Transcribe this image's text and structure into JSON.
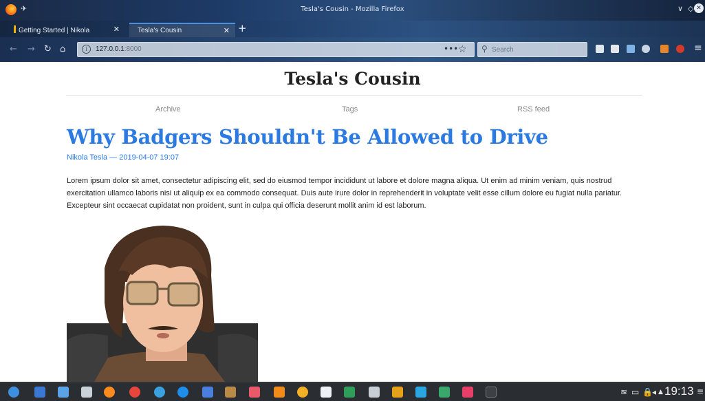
{
  "window": {
    "title": "Tesla's Cousin - Mozilla Firefox",
    "controls": [
      "∨",
      "◇"
    ]
  },
  "tabs": [
    {
      "label": "Getting Started | Nikola",
      "active": false
    },
    {
      "label": "Tesla's Cousin",
      "active": true
    }
  ],
  "navbar": {
    "url_host": "127.0.0.1",
    "url_port": ":8000",
    "search_placeholder": "Search"
  },
  "page": {
    "site_title": "Tesla's Cousin",
    "nav": [
      "Archive",
      "Tags",
      "RSS feed"
    ],
    "post_title": "Why Badgers Shouldn't Be Allowed to Drive",
    "post_meta": "Nikola Tesla — 2019-04-07 19:07",
    "post_body": "Lorem ipsum dolor sit amet, consectetur adipiscing elit, sed do eiusmod tempor incididunt ut labore et dolore magna aliqua. Ut enim ad minim veniam, quis nostrud exercitation ullamco laboris nisi ut aliquip ex ea commodo consequat. Duis aute irure dolor in reprehenderit in voluptate velit esse cillum dolore eu fugiat nulla pariatur. Excepteur sint occaecat cupidatat non proident, sunt in culpa qui officia deserunt mollit anim id est laborum."
  },
  "colors": {
    "link": "#2a7ae2",
    "taskbar": "#2a2e32"
  },
  "taskbar": {
    "clock": "19:13",
    "apps": [
      "app-launcher",
      "files",
      "folder",
      "notes",
      "firefox",
      "chrome",
      "telegram",
      "skype",
      "messenger",
      "paint",
      "photos",
      "vlc",
      "banana",
      "document",
      "bookmark",
      "editor",
      "beer",
      "activity",
      "image-viewer",
      "kde-app",
      "terminal"
    ]
  }
}
